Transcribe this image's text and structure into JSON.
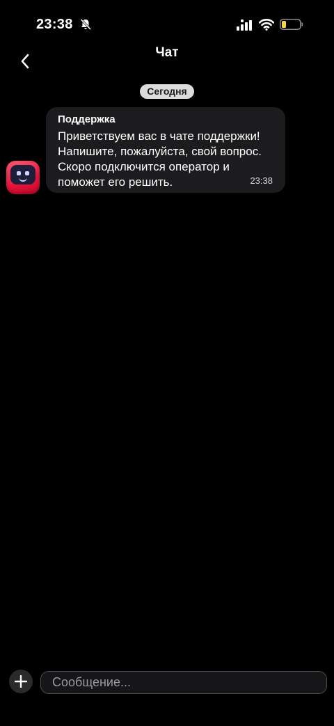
{
  "status_bar": {
    "time": "23:38"
  },
  "header": {
    "title": "Чат"
  },
  "chat": {
    "date_label": "Сегодня",
    "messages": [
      {
        "sender": "Поддержка",
        "text": "Приветствуем вас в чате поддержки! Напишите, пожалуйста, свой вопрос. Скоро подключится оператор и поможет его решить.",
        "time": "23:38"
      }
    ]
  },
  "composer": {
    "placeholder": "Сообщение..."
  },
  "icons": {
    "back": "chevron-left-icon",
    "bell": "bell-off-icon",
    "signal": "signal-icon",
    "wifi": "wifi-icon",
    "battery": "battery-icon",
    "add": "plus-icon",
    "avatar": "robot-icon"
  },
  "colors": {
    "background": "#000000",
    "bubble": "#1c1c1e",
    "date_pill": "#dcdcdc",
    "avatar": "#e8123a",
    "battery_level": "#f5d547"
  }
}
